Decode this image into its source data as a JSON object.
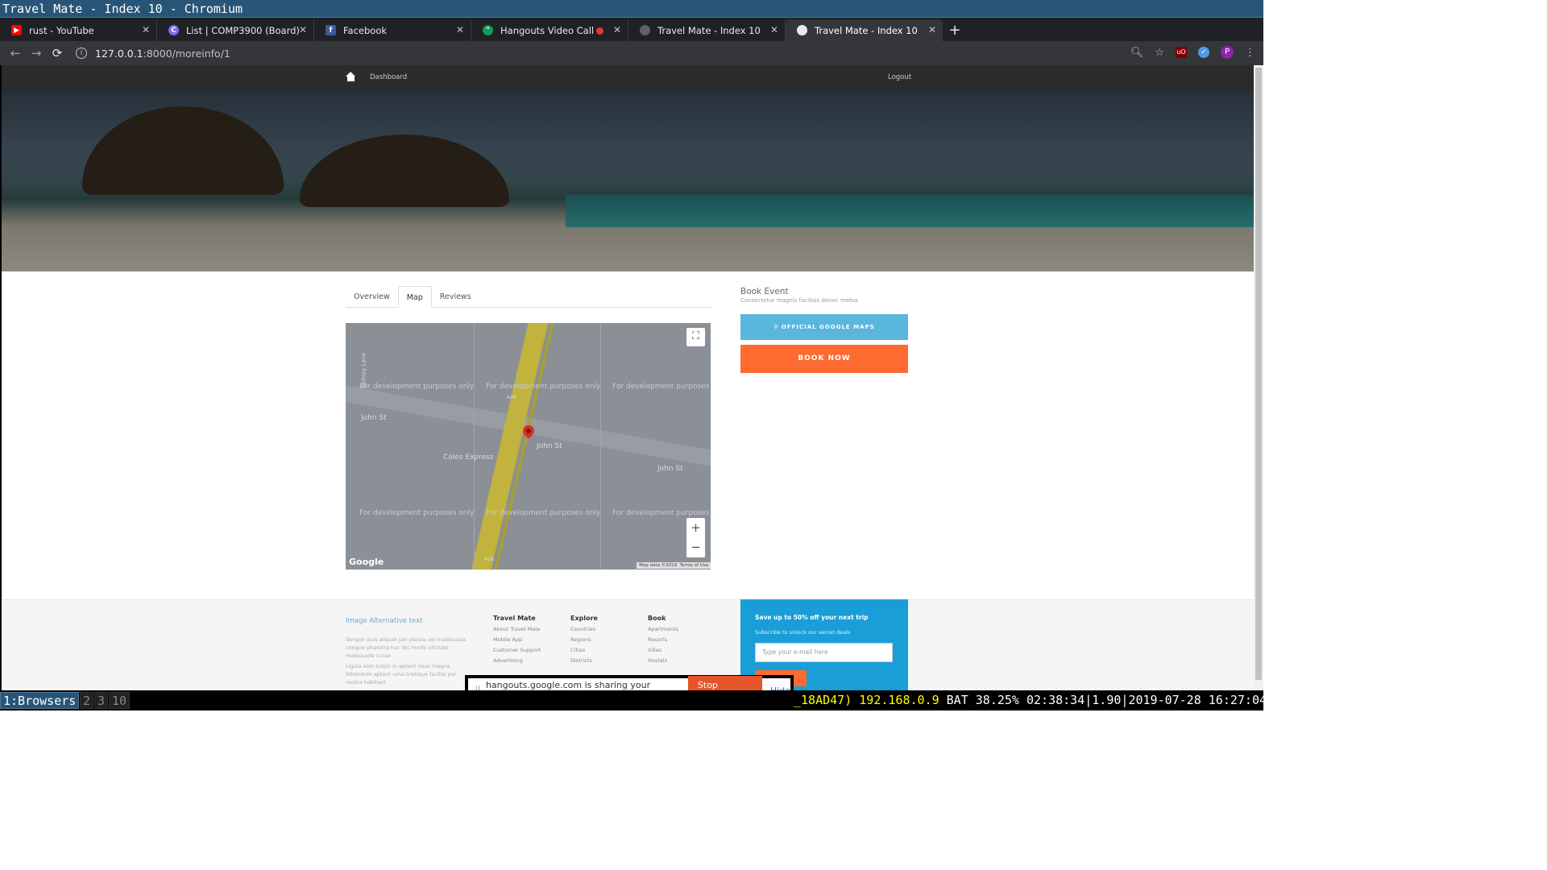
{
  "window_title": "Travel Mate - Index 10 - Chromium",
  "tabs": [
    {
      "title": "rust - YouTube",
      "color": "#ff0000"
    },
    {
      "title": "List | COMP3900 (Board)",
      "color": "#7b68ee"
    },
    {
      "title": "Facebook",
      "color": "#3b5998"
    },
    {
      "title": "Hangouts Video Call",
      "color": "#0f9d58"
    },
    {
      "title": "Travel Mate - Index 10",
      "color": "#5f6368"
    },
    {
      "title": "Travel Mate - Index 10",
      "color": "#e8eaed"
    }
  ],
  "url": {
    "host": "127.0.0.1",
    "path": ":8000/moreinfo/1"
  },
  "profile_letter": "P",
  "site_nav": {
    "dashboard": "Dashboard",
    "logout": "Logout"
  },
  "content_tabs": [
    "Overview",
    "Map",
    "Reviews"
  ],
  "map": {
    "dev_notice": "For development purposes only",
    "labels": {
      "john_st": "John St",
      "coles": "Coles Express",
      "sydney_lane": "Sydney Lane",
      "a28": "A28"
    },
    "google": "Google",
    "attribution": "Map data ©2019",
    "terms": "Terms of Use",
    "zoom_in": "+",
    "zoom_out": "−"
  },
  "booking": {
    "title": "Book Event",
    "subtitle": "Consectetur magnis facilisis donec metus",
    "maps_button": "OFFICIAL GOOGLE MAPS",
    "book_button": "BOOK NOW"
  },
  "footer": {
    "image_alt": "Image Alternative text",
    "para1": "Tempor duis aliquet per platea vel malesuada congue pharetra hac dis morbi ultricies malesuada curae",
    "para2": "Ligula sem turpis in aptent risus magna bibendum aptent urna tristique facilisi per nostra habitant",
    "columns": [
      {
        "title": "Travel Mate",
        "items": [
          "About Travel Mate",
          "Mobile App",
          "Customer Support",
          "Advertising"
        ]
      },
      {
        "title": "Explore",
        "items": [
          "Countries",
          "Regions",
          "Cities",
          "Districts"
        ]
      },
      {
        "title": "Book",
        "items": [
          "Apartments",
          "Resorts",
          "Villas",
          "Hostels"
        ]
      }
    ],
    "promo": {
      "title": "Save up to 50% off your next trip",
      "subtitle": "Subscribe to unlock our secret deals",
      "placeholder": "Type your e-mail here"
    }
  },
  "share_bar": {
    "text": "hangouts.google.com is sharing your screen.",
    "stop": "Stop sharing",
    "hide": "Hide"
  },
  "i3": {
    "workspaces": [
      "1:Browsers",
      "2",
      "3",
      "10"
    ],
    "status_yellow": "_18AD47) 192.168.0.9",
    "status_white": "BAT 38.25% 02:38:34|1.90|2019-07-28 16:27:04"
  }
}
